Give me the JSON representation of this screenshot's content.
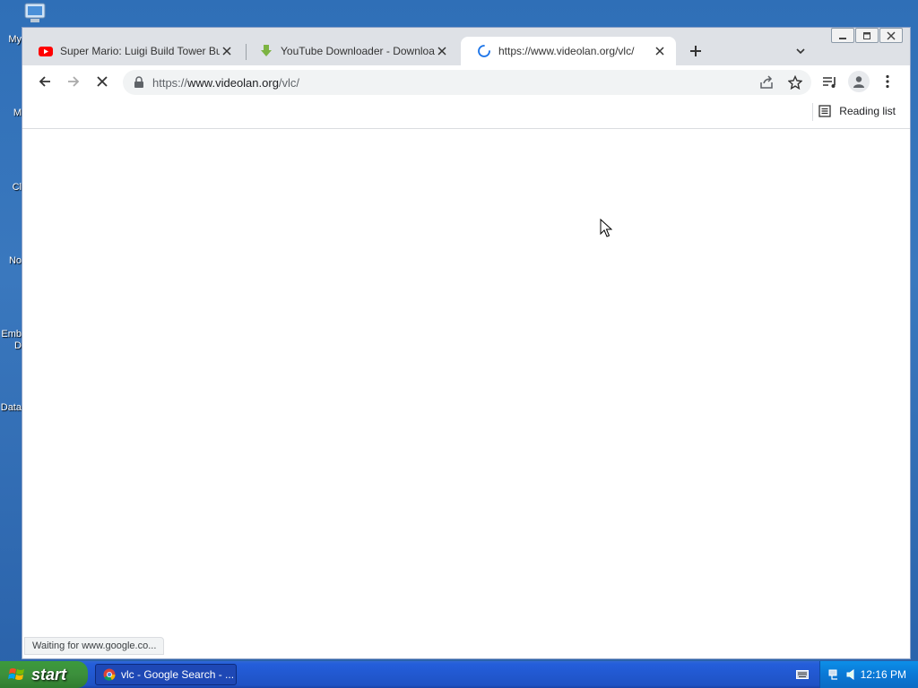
{
  "desktop": {
    "icons": [
      {
        "label": "My"
      },
      {
        "label": "M"
      },
      {
        "label": "Cl"
      },
      {
        "label": "No"
      },
      {
        "label": "Emb"
      },
      {
        "label": "D"
      },
      {
        "label": "Data"
      }
    ]
  },
  "browser": {
    "tabs": [
      {
        "title": "Super Mario: Luigi Build Tower But",
        "favicon": "youtube-icon"
      },
      {
        "title": "YouTube Downloader - Download Y",
        "favicon": "download-arrow-icon"
      },
      {
        "title": "https://www.videolan.org/vlc/",
        "favicon": "loading-spinner-icon"
      }
    ],
    "address": {
      "scheme": "https://",
      "host": "www.videolan.org",
      "path": "/vlc/"
    },
    "reading_list_label": "Reading list",
    "status_text": "Waiting for www.google.co..."
  },
  "taskbar": {
    "start_label": "start",
    "task_label": "vlc - Google Search - ...",
    "clock": "12:16 PM"
  },
  "colors": {
    "accent": "#1a73e8",
    "youtube": "#ff0000",
    "download_green": "#7cb342"
  }
}
